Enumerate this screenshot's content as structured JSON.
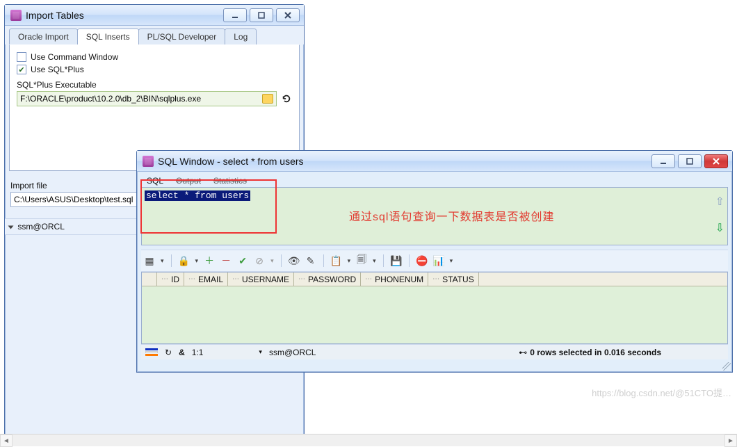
{
  "import_window": {
    "title": "Import Tables",
    "tabs": [
      "Oracle Import",
      "SQL Inserts",
      "PL/SQL Developer",
      "Log"
    ],
    "active_tab_index": 1,
    "use_command_window": {
      "label": "Use Command Window",
      "checked": false
    },
    "use_sqlplus": {
      "label": "Use SQL*Plus",
      "checked": true
    },
    "sqlplus_label": "SQL*Plus Executable",
    "sqlplus_path": "F:\\ORACLE\\product\\10.2.0\\db_2\\BIN\\sqlplus.exe",
    "import_file_label": "Import file",
    "import_file_path": "C:\\Users\\ASUS\\Desktop\\test.sql",
    "connection": "ssm@ORCL"
  },
  "sql_window": {
    "title": "SQL Window - select * from users",
    "tabs": {
      "sql": "SQL",
      "output": "Output",
      "statistics": "Statistics"
    },
    "query": "select * from  users",
    "annotation": "通过sql语句查询一下数据表是否被创建",
    "columns": [
      "ID",
      "EMAIL",
      "USERNAME",
      "PASSWORD",
      "PHONENUM",
      "STATUS"
    ],
    "status": {
      "row_col": "1:1",
      "connection": "ssm@ORCL",
      "rows_msg": "0 rows selected in 0.016 seconds"
    }
  },
  "watermark": "https://blog.csdn.net/@51CTO提…"
}
